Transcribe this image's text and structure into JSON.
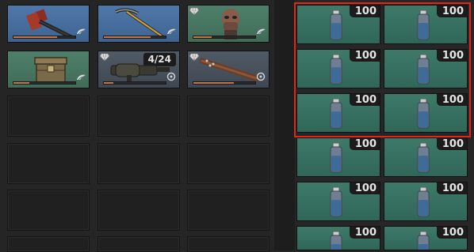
{
  "weapons": {
    "items": [
      {
        "name": "axe",
        "rarity": "blue",
        "durability": 0.7
      },
      {
        "name": "pickaxe",
        "rarity": "blue",
        "durability": 0.75
      },
      {
        "name": "mask-helmet",
        "rarity": "green",
        "durability": 0.3
      },
      {
        "name": "storage-crate",
        "rarity": "green",
        "durability": 0.25
      },
      {
        "name": "grenade-launcher",
        "rarity": "gray",
        "ammo_label": "4/24",
        "durability": 0.15
      },
      {
        "name": "spiked-bat",
        "rarity": "gray",
        "durability": 0.65
      }
    ]
  },
  "consumables": {
    "item": "medicine-bottle",
    "highlighted_rows": 3,
    "stacks": [
      {
        "count": "100"
      },
      {
        "count": "100"
      },
      {
        "count": "100"
      },
      {
        "count": "100"
      },
      {
        "count": "100"
      },
      {
        "count": "100"
      },
      {
        "count": "100"
      },
      {
        "count": "100"
      },
      {
        "count": "100"
      },
      {
        "count": "100"
      },
      {
        "count": "100"
      },
      {
        "count": "100"
      }
    ]
  },
  "colors": {
    "rarity_blue": "#4f78a9",
    "rarity_green": "#4f7f6a",
    "rarity_gray": "#515b66",
    "consumable_teal": "#3f7a69",
    "selection_red": "#e2241b",
    "durability": "#c7784a"
  }
}
